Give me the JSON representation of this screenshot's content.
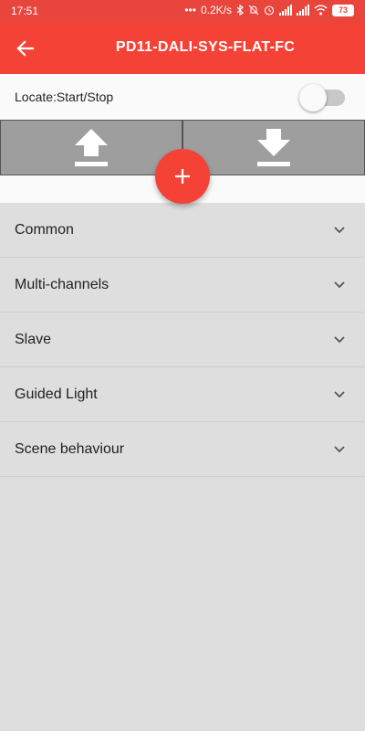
{
  "status_bar": {
    "time": "17:51",
    "net_speed": "0.2K/s",
    "battery": "73",
    "color": "#e8453c"
  },
  "app_bar": {
    "title": "PD11-DALI-SYS-FLAT-FC",
    "color": "#f44336"
  },
  "locate": {
    "label": "Locate:Start/Stop",
    "enabled": false
  },
  "transfer": {
    "upload_icon": "upload-icon",
    "download_icon": "download-icon"
  },
  "fab": {
    "icon": "plus-icon"
  },
  "sections": [
    {
      "label": "Common"
    },
    {
      "label": "Multi-channels"
    },
    {
      "label": "Slave"
    },
    {
      "label": "Guided Light"
    },
    {
      "label": "Scene behaviour"
    }
  ]
}
